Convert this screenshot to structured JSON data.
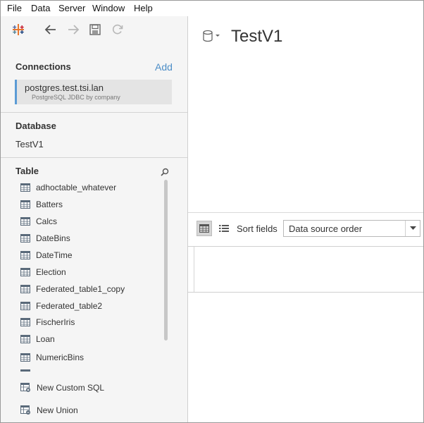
{
  "menubar": {
    "items": [
      "File",
      "Data",
      "Server",
      "Window",
      "Help"
    ]
  },
  "toolbar": {
    "icons": [
      "tableau-logo-icon",
      "back-arrow-icon",
      "forward-arrow-icon",
      "save-icon",
      "refresh-icon"
    ]
  },
  "connections": {
    "title": "Connections",
    "add_label": "Add",
    "items": [
      {
        "name": "postgres.test.tsi.lan",
        "subtitle": "PostgreSQL JDBC by company"
      }
    ]
  },
  "database": {
    "title": "Database",
    "selected": "TestV1"
  },
  "tables": {
    "title": "Table",
    "items": [
      "adhoctable_whatever",
      "Batters",
      "Calcs",
      "DateBins",
      "DateTime",
      "Election",
      "Federated_table1_copy",
      "Federated_table2",
      "FischerIris",
      "Loan",
      "NumericBins"
    ]
  },
  "bottom_actions": {
    "custom_sql": "New Custom SQL",
    "union": "New Union"
  },
  "main": {
    "datasource_title": "TestV1",
    "sort_label": "Sort fields",
    "sort_value": "Data source order"
  },
  "colors": {
    "accent": "#4d8ec7",
    "selection_bar": "#5b9bd5",
    "sidebar_bg": "#f5f5f5"
  }
}
